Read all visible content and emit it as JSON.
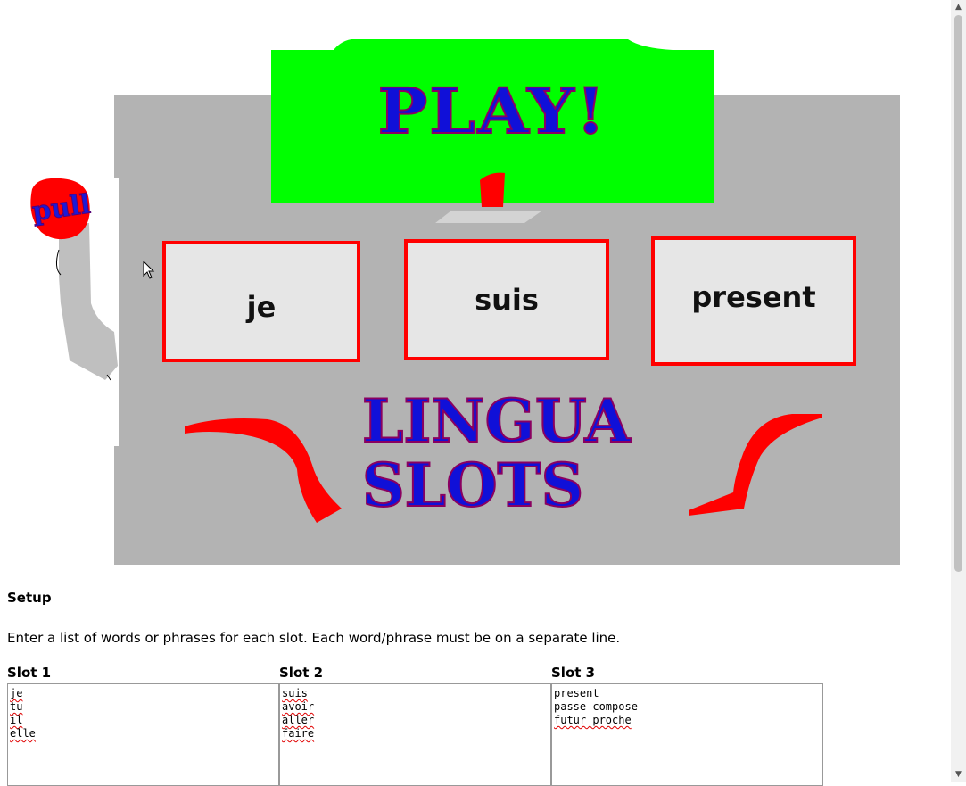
{
  "machine": {
    "play_label": "PLAY!",
    "pull_label": "pull",
    "title_line1": "LINGUA",
    "title_line2": "SLOTS",
    "reels": [
      "je",
      "suis",
      "present"
    ],
    "colors": {
      "body": "#b3b3b3",
      "play_sign": "#00ff00",
      "reel_border": "#ff0000",
      "title_text": "#1010d8",
      "accent_red": "#ff0000"
    }
  },
  "setup": {
    "title": "Setup",
    "instructions": "Enter a list of words or phrases for each slot. Each word/phrase must be on a separate line.",
    "slots": [
      {
        "label": "Slot 1",
        "lines": [
          "je",
          "tu",
          "il",
          "elle"
        ]
      },
      {
        "label": "Slot 2",
        "lines": [
          "suis",
          "avoir",
          "aller",
          "faire"
        ]
      },
      {
        "label": "Slot 3",
        "lines": [
          "present",
          "passe compose",
          "futur proche"
        ]
      }
    ]
  },
  "icons": {
    "cursor": "arrow-cursor-icon",
    "scroll_up": "chevron-up-icon",
    "scroll_down": "chevron-down-icon"
  }
}
